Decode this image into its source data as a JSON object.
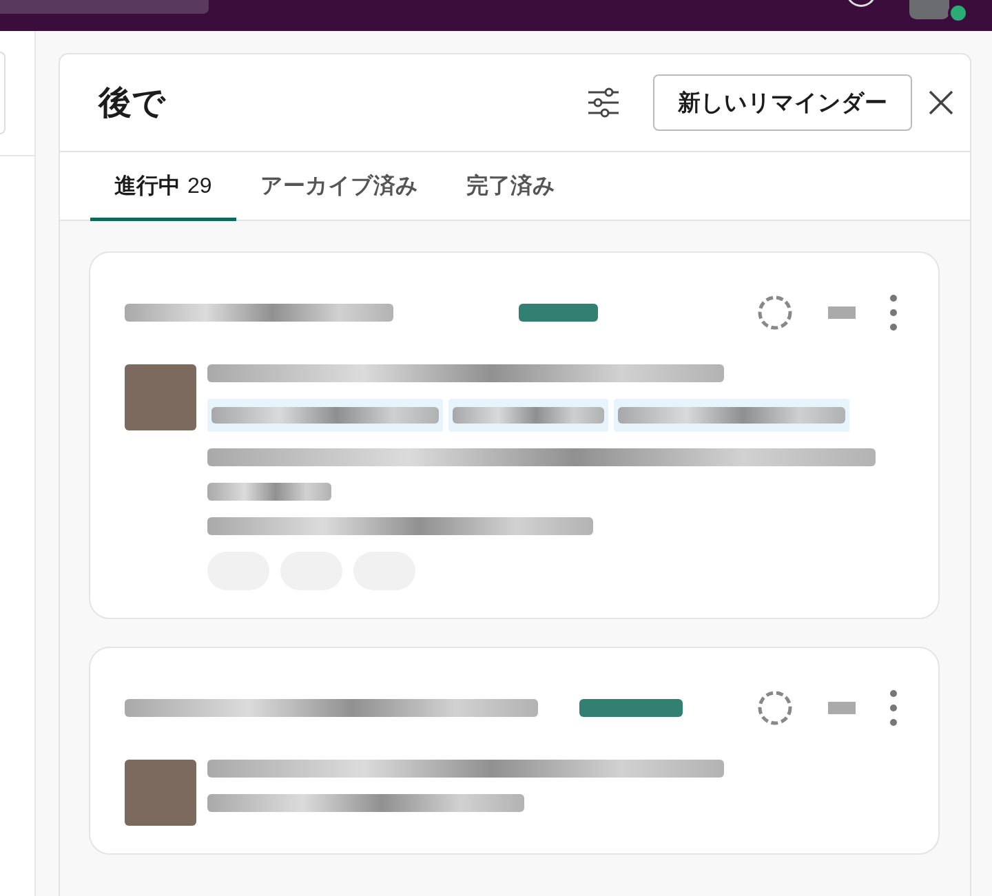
{
  "header": {
    "title": "後で",
    "new_reminder_button": "新しいリマインダー"
  },
  "tabs": [
    {
      "label": "進行中",
      "count": "29",
      "selected": true
    },
    {
      "label": "アーカイブ済み",
      "selected": false
    },
    {
      "label": "完了済み",
      "selected": false
    }
  ]
}
